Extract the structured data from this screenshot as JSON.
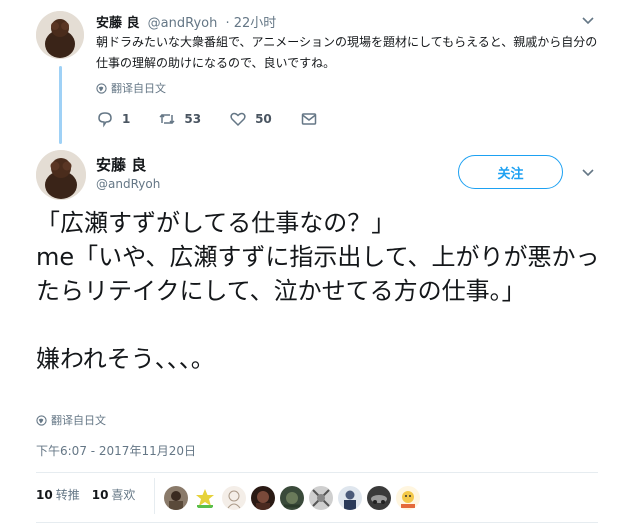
{
  "reply_tweet": {
    "name": "安藤 良",
    "handle": "@andRyoh",
    "time": "· 22小时",
    "text": "朝ドラみたいな大衆番組で、アニメーションの現場を題材にしてもらえると、親戚から自分の仕事の理解の助けになるので、良いですね。",
    "translate_label": "翻译自日文",
    "reply_count": "1",
    "retweet_count": "53",
    "like_count": "50",
    "icons": [
      "reply-icon",
      "retweet-icon",
      "heart-icon",
      "mail-icon",
      "chevron-down-icon",
      "globe-icon"
    ]
  },
  "main_tweet": {
    "name": "安藤 良",
    "handle": "@andRyoh",
    "follow_label": "关注",
    "text": "「広瀬すずがしてる仕事なの？」\nme「いや、広瀬すずに指示出して、上がりが悪かったらリテイクにして、泣かせてる方の仕事。」\n\n嫌われそう、、、。",
    "translate_label": "翻译自日文",
    "timestamp": "下午6:07 - 2017年11月20日",
    "retweets_num": "10",
    "retweets_label": "转推",
    "likes_num": "10",
    "likes_label": "喜欢"
  },
  "colors": {
    "accent": "#1da1f2",
    "thread_line": "#9fd1f6",
    "secondary_text": "#657786"
  }
}
